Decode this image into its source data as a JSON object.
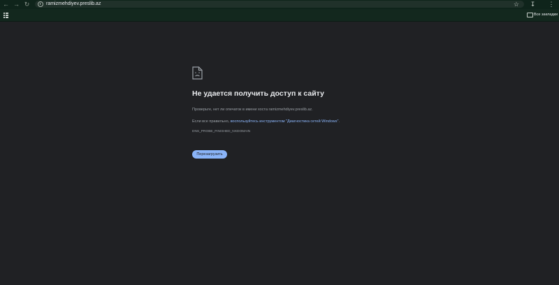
{
  "toolbar": {
    "url": "ramizmehdiyev.preslib.az",
    "back_icon": "arrow-left-icon",
    "forward_icon": "arrow-right-icon",
    "reload_icon": "reload-icon",
    "star_icon": "star-icon",
    "download_icon": "download-icon",
    "menu_icon": "more-vert-icon"
  },
  "bookmarks_bar": {
    "all_bookmarks_label": "Все закладки"
  },
  "error_page": {
    "heading": "Не удается получить доступ к сайту",
    "line1": "Проверьте, нет ли опечаток в имени хоста ramizmehdiyev.preslib.az.",
    "line2_prefix": "Если все правильно, ",
    "line2_link": "воспользуйтесь инструментом \"Диагностика сетей Windows\"",
    "line2_suffix": ".",
    "error_code": "DNS_PROBE_FINISHED_NXDOMAIN",
    "reload_button_label": "Перезагрузить"
  },
  "colors": {
    "page_background": "#202124",
    "toolbar_background": "#0f241b",
    "accent": "#8ab4f8",
    "text_primary": "#e8eaed",
    "text_secondary": "#9aa0a6"
  }
}
